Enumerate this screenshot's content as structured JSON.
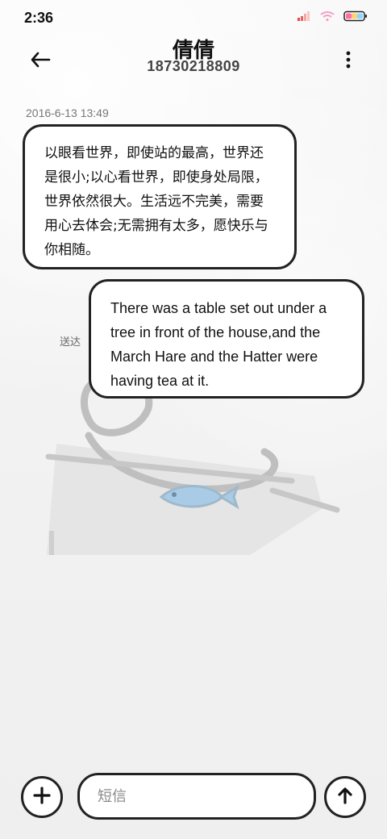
{
  "status_bar": {
    "time": "2:36",
    "icons": [
      "signal-icon",
      "wifi-icon",
      "battery-icon"
    ]
  },
  "header": {
    "name": "倩倩",
    "number": "18730218809",
    "back_icon": "back-arrow-icon",
    "more_icon": "more-vertical-icon"
  },
  "conversation": {
    "timestamp": "2016-6-13 13:49",
    "messages": [
      {
        "direction": "incoming",
        "text": "以眼看世界，即使站的最高，世界还是很小;以心看世界，即使身处局限，世界依然很大。生活远不完美，需要用心去体会;无需拥有太多，愿快乐与你相随。"
      },
      {
        "direction": "outgoing",
        "text": "There was a table set out under a tree in front of the house,and the March Hare and the Hatter were having tea at it.",
        "status": "送达"
      }
    ]
  },
  "composer": {
    "placeholder": "短信",
    "add_icon": "plus-circle-icon",
    "send_icon": "send-arrow-up-icon"
  },
  "colors": {
    "bubble_border": "#222222",
    "bubble_fill": "#ffffff",
    "illustration_fish": "#a9cbe6",
    "timestamp_text": "#777777"
  }
}
